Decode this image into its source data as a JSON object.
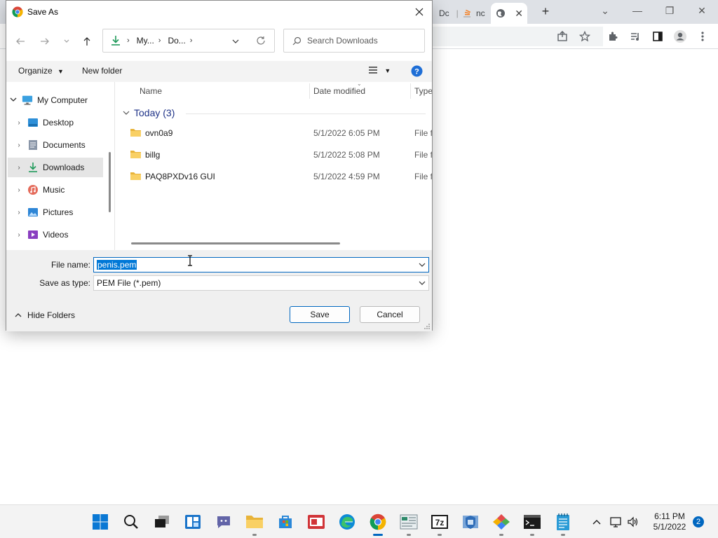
{
  "browser": {
    "tabs": [
      {
        "label": "Dc",
        "icon": "docs-icon"
      },
      {
        "label": "nc",
        "icon": "stackoverflow-icon"
      },
      {
        "label": "",
        "icon": "globe-icon",
        "active": true
      }
    ],
    "new_tab_symbol": "+"
  },
  "dialog": {
    "title": "Save As",
    "breadcrumb": [
      "My...",
      "Do..."
    ],
    "search_placeholder": "Search Downloads",
    "commands": {
      "organize": "Organize",
      "new_folder": "New folder"
    },
    "nav_items": [
      {
        "label": "My Computer",
        "icon": "computer-icon",
        "expanded": true
      },
      {
        "label": "Desktop",
        "icon": "desktop-icon"
      },
      {
        "label": "Documents",
        "icon": "documents-icon"
      },
      {
        "label": "Downloads",
        "icon": "downloads-icon",
        "selected": true
      },
      {
        "label": "Music",
        "icon": "music-icon"
      },
      {
        "label": "Pictures",
        "icon": "pictures-icon"
      },
      {
        "label": "Videos",
        "icon": "videos-icon"
      }
    ],
    "columns": {
      "name": "Name",
      "date": "Date modified",
      "type": "Type"
    },
    "group_label": "Today (3)",
    "files": [
      {
        "name": "ovn0a9",
        "date": "5/1/2022 6:05 PM",
        "type": "File fo"
      },
      {
        "name": "billg",
        "date": "5/1/2022 5:08 PM",
        "type": "File fo"
      },
      {
        "name": "PAQ8PXDv16 GUI",
        "date": "5/1/2022 4:59 PM",
        "type": "File fo"
      }
    ],
    "file_name_label": "File name:",
    "file_name_value": "penis.pem",
    "save_type_label": "Save as type:",
    "save_type_value": "PEM File (*.pem)",
    "hide_folders": "Hide Folders",
    "save_button": "Save",
    "cancel_button": "Cancel"
  },
  "taskbar": {
    "time": "6:11 PM",
    "date": "5/1/2022",
    "notification_count": "2"
  },
  "colors": {
    "accent": "#0067c0",
    "selection": "#0078d7",
    "folder": "#f4c44e"
  }
}
